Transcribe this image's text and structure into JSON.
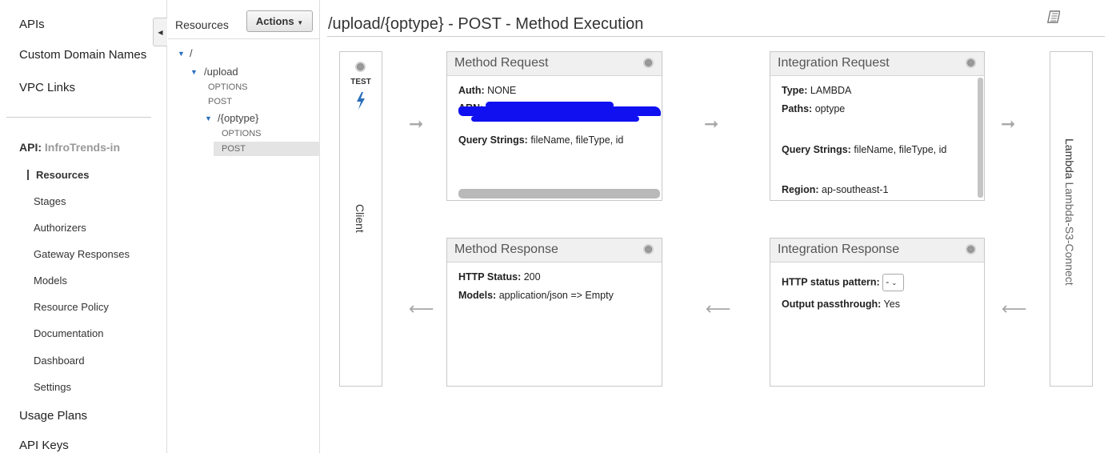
{
  "nav": {
    "top_items": [
      "APIs",
      "Custom Domain Names",
      "VPC Links"
    ],
    "api_label": "API:",
    "api_name": "InfroTrends-in",
    "sub_items": [
      "Resources",
      "Stages",
      "Authorizers",
      "Gateway Responses",
      "Models",
      "Resource Policy",
      "Documentation",
      "Dashboard",
      "Settings"
    ],
    "bottom_items": [
      "Usage Plans",
      "API Keys"
    ]
  },
  "tree": {
    "heading": "Resources",
    "actions_label": "Actions",
    "nodes": {
      "root": "/",
      "upload": "/upload",
      "upload_options": "OPTIONS",
      "upload_post": "POST",
      "optype": "/{optype}",
      "optype_options": "OPTIONS",
      "optype_post": "POST"
    }
  },
  "main": {
    "title": "/upload/{optype} - POST - Method Execution",
    "client": {
      "test_label": "TEST",
      "label": "Client"
    },
    "method_request": {
      "title": "Method Request",
      "auth_key": "Auth:",
      "auth_val": "NONE",
      "arn_key": "ARN:",
      "query_key": "Query Strings:",
      "query_val": "fileName, fileType, id"
    },
    "integration_request": {
      "title": "Integration Request",
      "type_key": "Type:",
      "type_val": "LAMBDA",
      "paths_key": "Paths:",
      "paths_val": "optype",
      "query_key": "Query Strings:",
      "query_val": "fileName, fileType, id",
      "region_key": "Region:",
      "region_val": "ap-southeast-1"
    },
    "method_response": {
      "title": "Method Response",
      "status_key": "HTTP Status:",
      "status_val": "200",
      "models_key": "Models:",
      "models_val": "application/json => Empty"
    },
    "integration_response": {
      "title": "Integration Response",
      "pattern_key": "HTTP status pattern:",
      "pattern_val": "-",
      "passthrough_key": "Output passthrough:",
      "passthrough_val": "Yes"
    },
    "lambda": {
      "prefix": "Lambda",
      "name": "Lambda-S3-Connect"
    },
    "arrow_right": "➞",
    "arrow_left": "⟵"
  },
  "colors": {
    "redaction": "#1010f0",
    "link_blue": "#2a6ebb"
  }
}
